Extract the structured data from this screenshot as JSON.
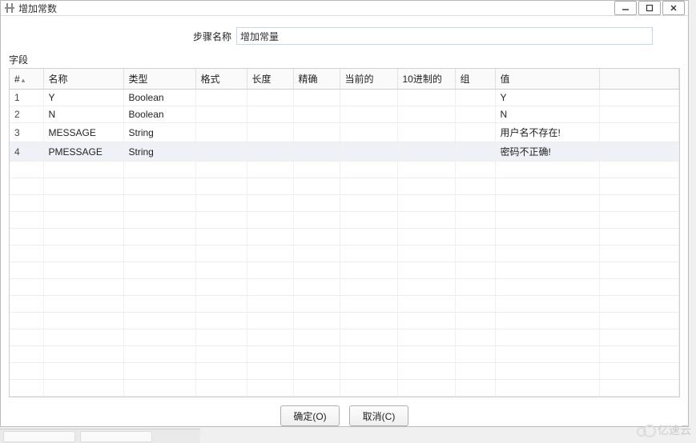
{
  "window": {
    "title": "增加常数"
  },
  "stepName": {
    "label": "步骤名称",
    "value": "增加常量"
  },
  "fieldsLabel": "字段",
  "columns": {
    "num": "#",
    "name": "名称",
    "type": "类型",
    "format": "格式",
    "length": "长度",
    "precision": "精确",
    "current": "当前的",
    "decimal": "10进制的",
    "group": "组",
    "value": "值"
  },
  "rows": [
    {
      "num": "1",
      "name": "Y",
      "type": "Boolean",
      "format": "",
      "length": "",
      "precision": "",
      "current": "",
      "decimal": "",
      "group": "",
      "value": "Y"
    },
    {
      "num": "2",
      "name": "N",
      "type": "Boolean",
      "format": "",
      "length": "",
      "precision": "",
      "current": "",
      "decimal": "",
      "group": "",
      "value": "N"
    },
    {
      "num": "3",
      "name": "MESSAGE",
      "type": "String",
      "format": "",
      "length": "",
      "precision": "",
      "current": "",
      "decimal": "",
      "group": "",
      "value": "用户名不存在!"
    },
    {
      "num": "4",
      "name": "PMESSAGE",
      "type": "String",
      "format": "",
      "length": "",
      "precision": "",
      "current": "",
      "decimal": "",
      "group": "",
      "value": "密码不正确!"
    }
  ],
  "selectedRowIndex": 3,
  "emptyRows": 14,
  "buttons": {
    "ok": "确定(O)",
    "cancel": "取消(C)"
  },
  "watermark": "亿速云"
}
